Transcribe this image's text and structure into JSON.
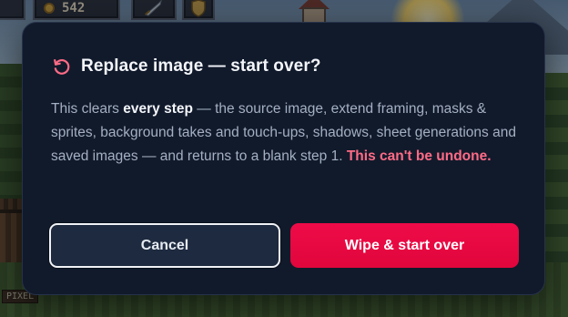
{
  "hud": {
    "coins_value": "542",
    "coin_icon": "coin-icon",
    "sword_icon": "sword-icon",
    "shield_icon": "shield-icon"
  },
  "backdrop": {
    "pixel_tag": "PIXEL"
  },
  "dialog": {
    "icon": "reset-icon",
    "title": "Replace image — start over?",
    "body": {
      "intro": "This clears ",
      "emphasis": "every step",
      "rest": " — the source image, extend framing, masks & sprites, background takes and touch-ups, shadows, sheet generations and saved images — and returns to a blank step 1. ",
      "warning": "This can't be undone."
    },
    "cancel_label": "Cancel",
    "confirm_label": "Wipe & start over"
  },
  "colors": {
    "dialog_bg": "#111a2b",
    "accent_danger": "#e8073f",
    "warning_text": "#ff6b86",
    "icon": "#ff6b86"
  }
}
